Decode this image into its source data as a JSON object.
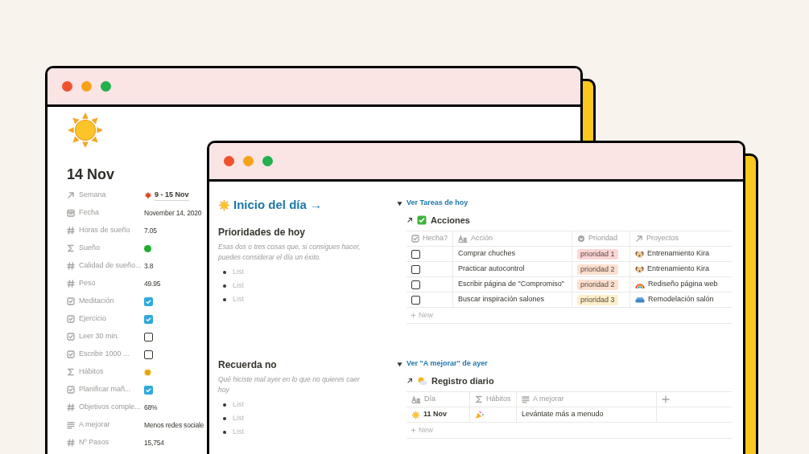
{
  "back_window": {
    "page_title": "14 Nov",
    "properties": [
      {
        "kind": "relation",
        "label": "Semana",
        "value": {
          "kind": "relation",
          "text": "9 - 15 Nov"
        }
      },
      {
        "kind": "date",
        "label": "Fecha",
        "value": {
          "kind": "text",
          "text": "November 14, 2020"
        }
      },
      {
        "kind": "number",
        "label": "Horas de sueño",
        "value": {
          "kind": "text",
          "text": "7.05"
        }
      },
      {
        "kind": "formula",
        "label": "Sueño",
        "value": {
          "kind": "dot",
          "color": "#1fae2b"
        }
      },
      {
        "kind": "number",
        "label": "Calidad de sueño...",
        "value": {
          "kind": "text",
          "text": "3.8"
        }
      },
      {
        "kind": "number",
        "label": "Peso",
        "value": {
          "kind": "text",
          "text": "49.95"
        }
      },
      {
        "kind": "checkbox",
        "label": "Meditación",
        "value": {
          "kind": "checkbox",
          "checked": true
        }
      },
      {
        "kind": "checkbox",
        "label": "Ejercicio",
        "value": {
          "kind": "checkbox",
          "checked": true
        }
      },
      {
        "kind": "checkbox",
        "label": "Leer 30 min.",
        "value": {
          "kind": "checkbox",
          "checked": false
        }
      },
      {
        "kind": "checkbox",
        "label": "Escribir 1000 ...",
        "value": {
          "kind": "checkbox",
          "checked": false
        }
      },
      {
        "kind": "formula",
        "label": "Hábitos",
        "value": {
          "kind": "face"
        }
      },
      {
        "kind": "checkbox",
        "label": "Planificar mañ...",
        "value": {
          "kind": "checkbox",
          "checked": true
        }
      },
      {
        "kind": "number",
        "label": "Objetivos comple...",
        "value": {
          "kind": "text",
          "text": "68%"
        }
      },
      {
        "kind": "text",
        "label": "A mejorar",
        "value": {
          "kind": "text",
          "text": "Menos redes sociale"
        }
      },
      {
        "kind": "number",
        "label": "Nº Pasos",
        "value": {
          "kind": "text",
          "text": "15,754"
        }
      }
    ]
  },
  "front_window": {
    "title": "Inicio del día →",
    "sections": [
      {
        "heading": "Prioridades de hoy",
        "hint": "Esas dos o tres cosas que, si consigues hacer, puedes considerar el día un éxito.",
        "items": [
          {
            "placeholder": "List"
          },
          {
            "placeholder": "List"
          },
          {
            "placeholder": "List"
          }
        ]
      },
      {
        "heading": "Recuerda no",
        "hint": "Qué hiciste mal ayer en lo que no quieres caer hoy",
        "items": [
          {
            "placeholder": "List"
          },
          {
            "placeholder": "List"
          },
          {
            "placeholder": "List"
          }
        ]
      }
    ],
    "toggles": [
      {
        "label": "Ver Tareas de hoy",
        "expanded": true,
        "database": {
          "kind": "tasks",
          "title": "Acciones",
          "columns": [
            {
              "kind": "checkbox",
              "label": "Hecha?"
            },
            {
              "kind": "title",
              "label": "Acción"
            },
            {
              "kind": "select",
              "label": "Prioridad"
            },
            {
              "kind": "relation",
              "label": "Proyectos"
            }
          ],
          "rows": [
            {
              "cells": [
                {
                  "kind": "checkbox",
                  "checked": false
                },
                {
                  "kind": "text",
                  "text": "Comprar chuches"
                },
                {
                  "kind": "tag",
                  "text": "prioridad 1",
                  "color": "#fdd6d6"
                },
                {
                  "kind": "dog_page",
                  "text": "Entrenamiento Kira"
                }
              ]
            },
            {
              "cells": [
                {
                  "kind": "checkbox",
                  "checked": false
                },
                {
                  "kind": "text",
                  "text": "Practicar autocontrol"
                },
                {
                  "kind": "tag",
                  "text": "prioridad 2",
                  "color": "#fde0cf"
                },
                {
                  "kind": "dog_page",
                  "text": "Entrenamiento Kira"
                }
              ]
            },
            {
              "cells": [
                {
                  "kind": "checkbox",
                  "checked": false
                },
                {
                  "kind": "text",
                  "text": "Escribir página de \"Compromiso\""
                },
                {
                  "kind": "tag",
                  "text": "prioridad 2",
                  "color": "#fde0cf"
                },
                {
                  "kind": "rainbow_page",
                  "text": "Rediseño página web"
                }
              ]
            },
            {
              "cells": [
                {
                  "kind": "checkbox",
                  "checked": false
                },
                {
                  "kind": "text",
                  "text": "Buscar inspiración salones"
                },
                {
                  "kind": "tag",
                  "text": "prioridad 3",
                  "color": "#fcefc9"
                },
                {
                  "kind": "sofa_page",
                  "text": "Remodelación salón"
                }
              ]
            }
          ],
          "new_label": "New"
        }
      },
      {
        "label": "Ver \"A mejorar\" de ayer",
        "expanded": true,
        "database": {
          "kind": "log",
          "title": "Registro diario",
          "columns": [
            {
              "kind": "title",
              "label": "Día"
            },
            {
              "kind": "formula",
              "label": "Hábitos"
            },
            {
              "kind": "text",
              "label": "A mejorar"
            },
            {
              "kind": "add"
            }
          ],
          "rows": [
            {
              "cells": [
                {
                  "kind": "sun_page",
                  "text": "11 Nov"
                },
                {
                  "kind": "party"
                },
                {
                  "kind": "text",
                  "text": "Levántate más a menudo"
                },
                {
                  "kind": "empty"
                }
              ]
            }
          ],
          "new_label": "New"
        }
      }
    ]
  }
}
